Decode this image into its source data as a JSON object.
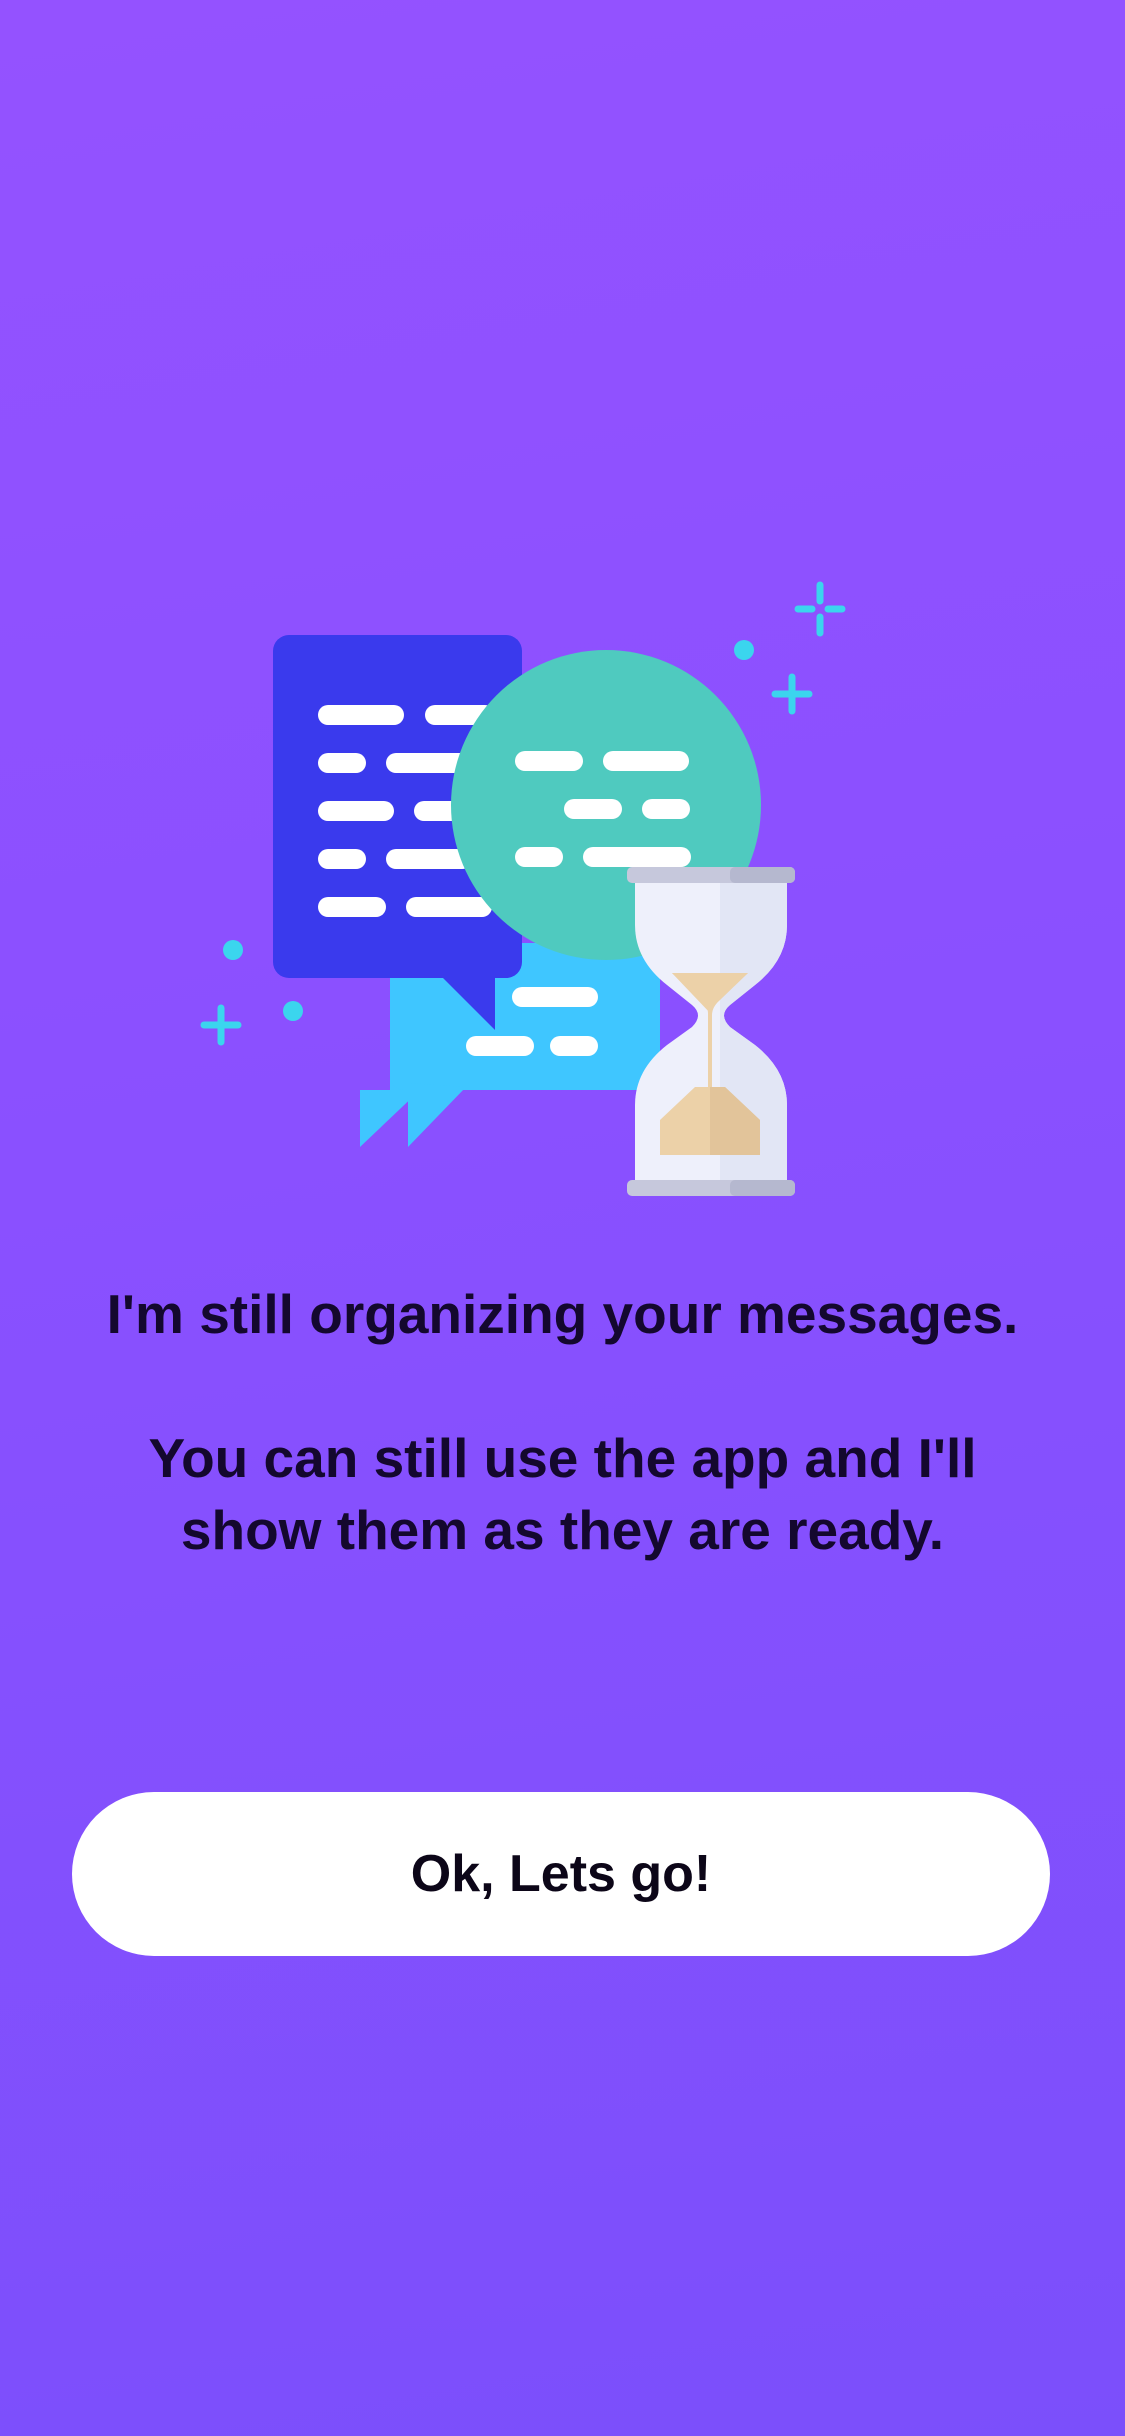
{
  "onboarding": {
    "message_line1": "I'm still organizing your messages.",
    "message_line2": "You can still use the app and I'll show them as they are ready.",
    "button_label": "Ok, Lets go!"
  },
  "illustration": {
    "icon": "chat-bubbles-hourglass-icon",
    "colors": {
      "blue_bubble": "#3a3aed",
      "green_bubble": "#4fcabf",
      "light_blue_bubble": "#3fc6ff",
      "hourglass_glass": "#eef0fb",
      "hourglass_sand": "#ecd1a8",
      "sparkle": "#3bd5ee"
    }
  },
  "theme": {
    "background_top": "#9452ff",
    "background_bottom": "#7b4ffb",
    "text": "#14082e",
    "button_bg": "#ffffff"
  }
}
